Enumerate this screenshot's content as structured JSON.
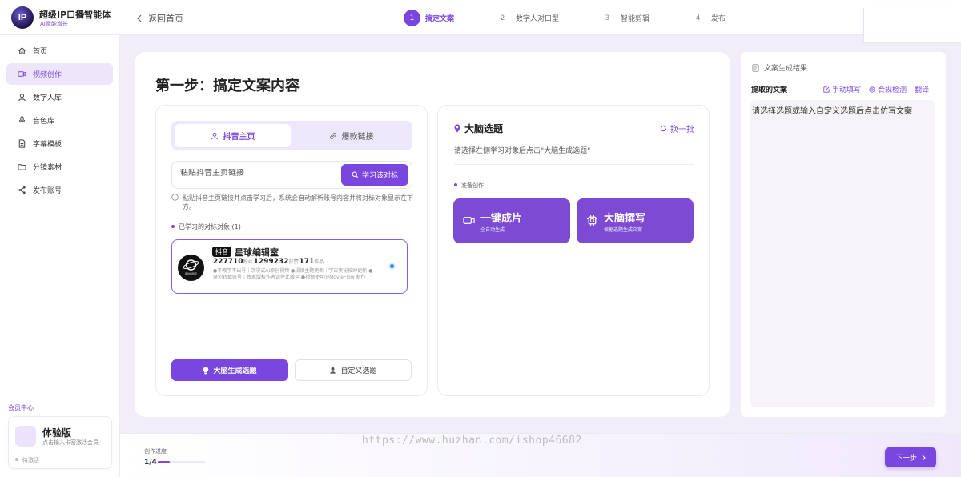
{
  "brand": {
    "logo_text": "IP",
    "title": "超级IP口播智能体",
    "subtitle": "AI赋能增长"
  },
  "header": {
    "back_label": "返回首页"
  },
  "steps": [
    {
      "num": "1",
      "label": "搞定文案",
      "active": true
    },
    {
      "num": "2",
      "label": "数字人对口型"
    },
    {
      "num": "3",
      "label": "智能剪辑"
    },
    {
      "num": "4",
      "label": "发布"
    }
  ],
  "sidebar": {
    "items": [
      {
        "label": "首页",
        "icon": "home-icon"
      },
      {
        "label": "视频创作",
        "icon": "video-icon",
        "active": true
      },
      {
        "label": "数字人库",
        "icon": "user-icon"
      },
      {
        "label": "音色库",
        "icon": "mic-icon"
      },
      {
        "label": "字幕模板",
        "icon": "document-icon"
      },
      {
        "label": "分镜素材",
        "icon": "folder-icon"
      },
      {
        "label": "发布账号",
        "icon": "share-icon"
      }
    ],
    "member_label": "会员中心",
    "member": {
      "title": "体验版",
      "subtitle": "点击输入卡密激活会员",
      "status": "待激活"
    }
  },
  "main": {
    "title": "第一步：搞定文案内容",
    "left": {
      "tabs": [
        "抖音主页",
        "爆款链接"
      ],
      "input_placeholder": "粘贴抖音主页链接",
      "learn_button": "学习该对标",
      "hint": "粘贴抖音主页链接并点击学习后，系统会自动解析账号内容并将对标对象显示在下方。",
      "learned_label": "已学习的对标对象 (1)",
      "account": {
        "platform": "抖音",
        "name": "星球编辑室",
        "avatar_text": "星球编辑室",
        "followers": "227710",
        "followers_unit": "粉丝",
        "likes": "1299232",
        "likes_unit": "获赞",
        "works": "171",
        "works_unit": "作品",
        "desc": "●不教学不出号｜沉浸式AI原创视频 ●规律主题更新｜宇宙奥秘按时更新 ●原创转载账号｜独家版权作者请停止搬运 ●视频使用@MovieFlow 制作",
        "selected": true
      },
      "btn_generate": "大脑生成选题",
      "btn_custom": "自定义选题"
    },
    "right": {
      "title": "大脑选题",
      "swap_label": "换一批",
      "hint": "请选择左侧学习对象后点击\"大脑生成选题\"",
      "prep_label": "准备创作",
      "actions": [
        {
          "title": "一键成片",
          "subtitle": "全自动生成",
          "icon": "video-camera-icon"
        },
        {
          "title": "大脑撰写",
          "subtitle": "根据选题生成文案",
          "icon": "cpu-icon"
        }
      ]
    }
  },
  "result": {
    "title": "文案生成结果",
    "sub_label": "提取的文案",
    "tools": [
      "手动填写",
      "合规检测",
      "翻译"
    ],
    "placeholder": "请选择选题或输入自定义选题后点击仿写文案"
  },
  "bottom": {
    "progress_label": "创作进度",
    "progress_text": "1/4",
    "progress_value": 0.25,
    "next_button": "下一步"
  },
  "watermark": "https://www.huzhan.com/ishop46682",
  "colors": {
    "accent": "#7a46e0",
    "accent_light": "#ede6fb",
    "action_card": "#7d4ad3",
    "radio_blue": "#2e8fe5"
  }
}
